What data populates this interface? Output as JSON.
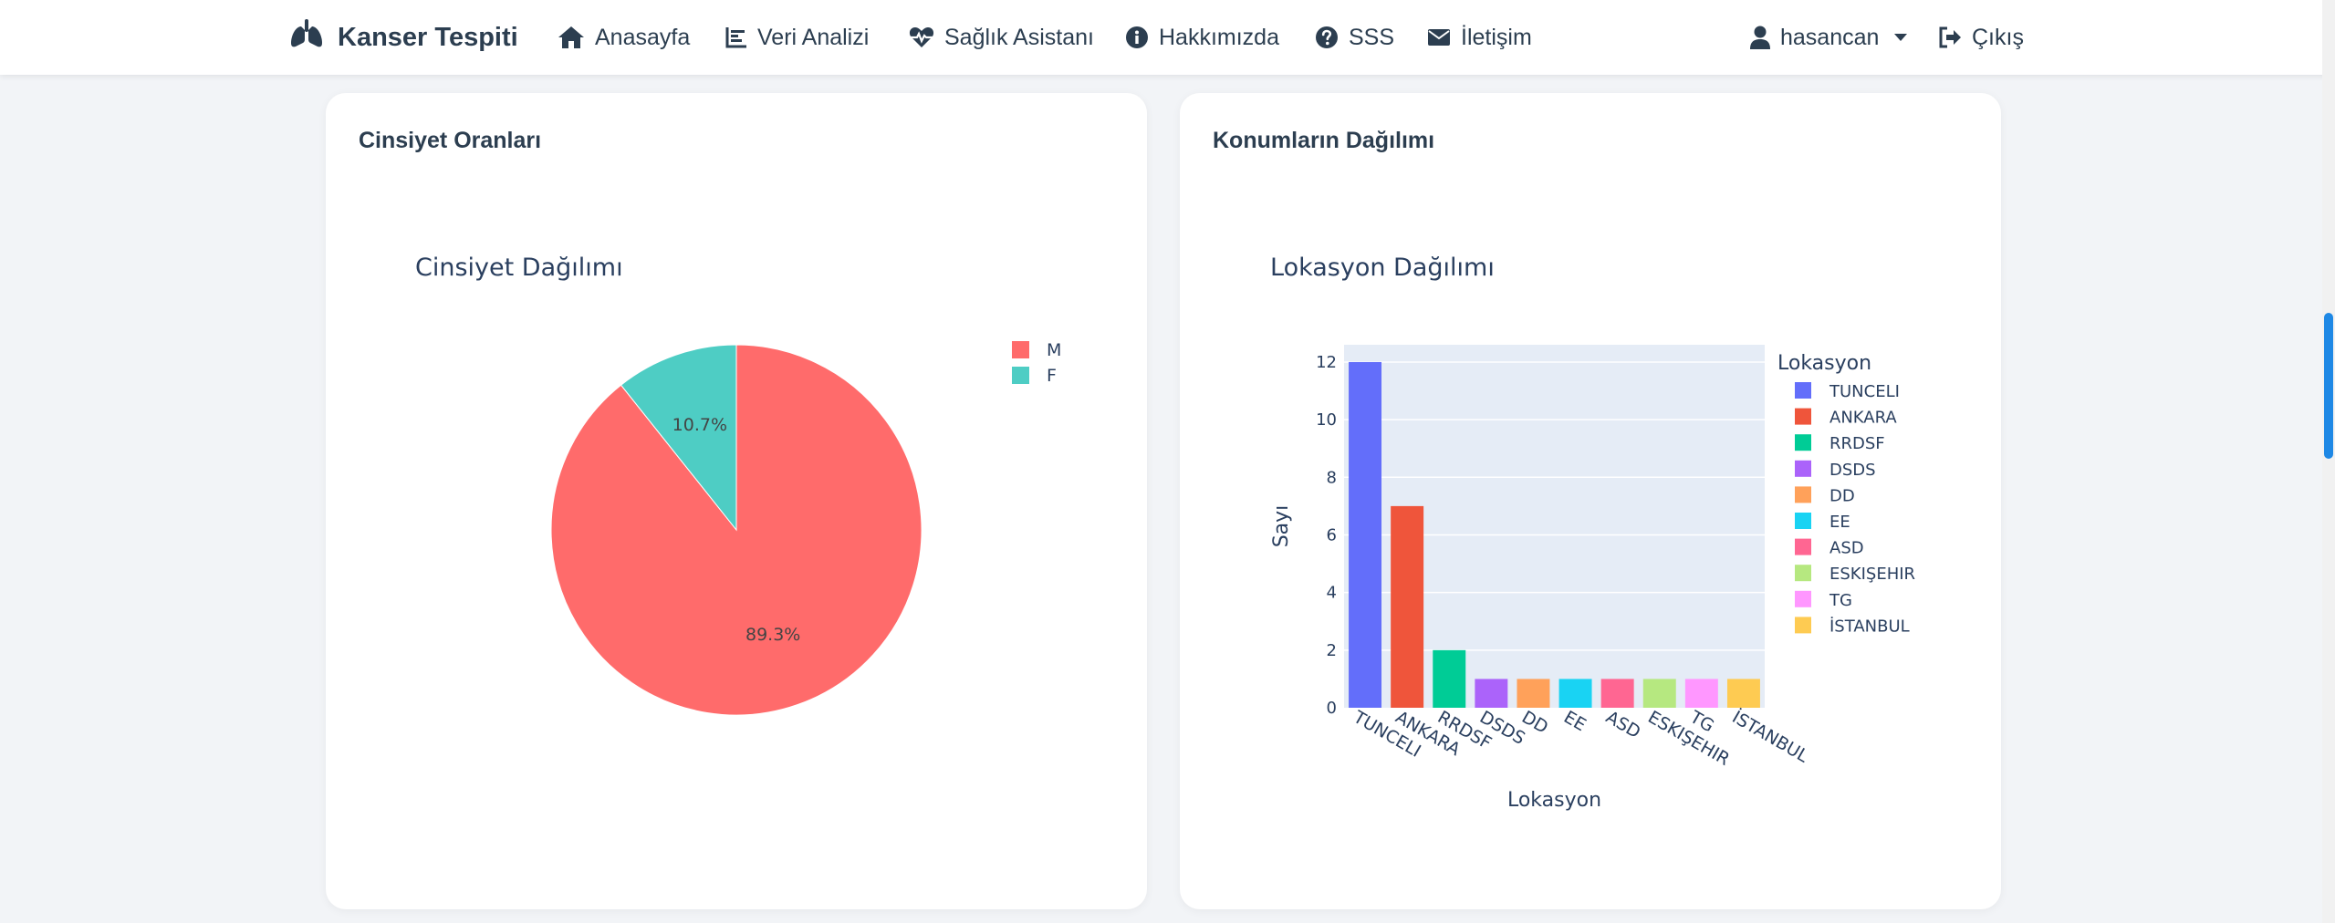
{
  "app": {
    "brand": "Kanser Tespiti",
    "brand_icon": "lungs-icon"
  },
  "nav": {
    "items": [
      {
        "label": "Anasayfa",
        "icon": "home-icon"
      },
      {
        "label": "Veri Analizi",
        "icon": "bar-chart-icon"
      },
      {
        "label": "Sağlık Asistanı",
        "icon": "heartbeat-icon"
      },
      {
        "label": "Hakkımızda",
        "icon": "info-circle-icon"
      },
      {
        "label": "SSS",
        "icon": "question-circle-icon"
      },
      {
        "label": "İletişim",
        "icon": "envelope-icon"
      }
    ],
    "user": {
      "label": "hasancan",
      "icon": "user-icon"
    },
    "logout": {
      "label": "Çıkış",
      "icon": "sign-out-icon"
    }
  },
  "cards": {
    "gender": {
      "title": "Cinsiyet Oranları"
    },
    "location": {
      "title": "Konumların Dağılımı"
    }
  },
  "colors": {
    "accent_scroll": "#1e88e5",
    "plot_bg": "#e5ecf6"
  },
  "chart_data": [
    {
      "type": "pie",
      "title": "Cinsiyet Dağılımı",
      "labels": [
        "M",
        "F"
      ],
      "values": [
        89.3,
        10.7
      ],
      "text_labels": [
        "89.3%",
        "10.7%"
      ],
      "colors": [
        "#ff6b6b",
        "#4ecdc4"
      ],
      "legend": "top-right"
    },
    {
      "type": "bar",
      "title": "Lokasyon Dağılımı",
      "xlabel": "Lokasyon",
      "ylabel": "Sayı",
      "ylim": [
        0,
        12.6
      ],
      "yticks": [
        0,
        2,
        4,
        6,
        8,
        10,
        12
      ],
      "grid": true,
      "legend_title": "Lokasyon",
      "legend": "right",
      "categories": [
        "TUNCELI",
        "ANKARA",
        "RRDSF",
        "DSDS",
        "DD",
        "EE",
        "ASD",
        "ESKIŞEHIR",
        "TG",
        "İSTANBUL"
      ],
      "values": [
        12,
        7,
        2,
        1,
        1,
        1,
        1,
        1,
        1,
        1
      ],
      "colors": [
        "#636efa",
        "#ef553b",
        "#00cc96",
        "#ab63fa",
        "#ffa15a",
        "#19d3f3",
        "#ff6692",
        "#b6e880",
        "#ff97ff",
        "#fecb52"
      ]
    }
  ]
}
